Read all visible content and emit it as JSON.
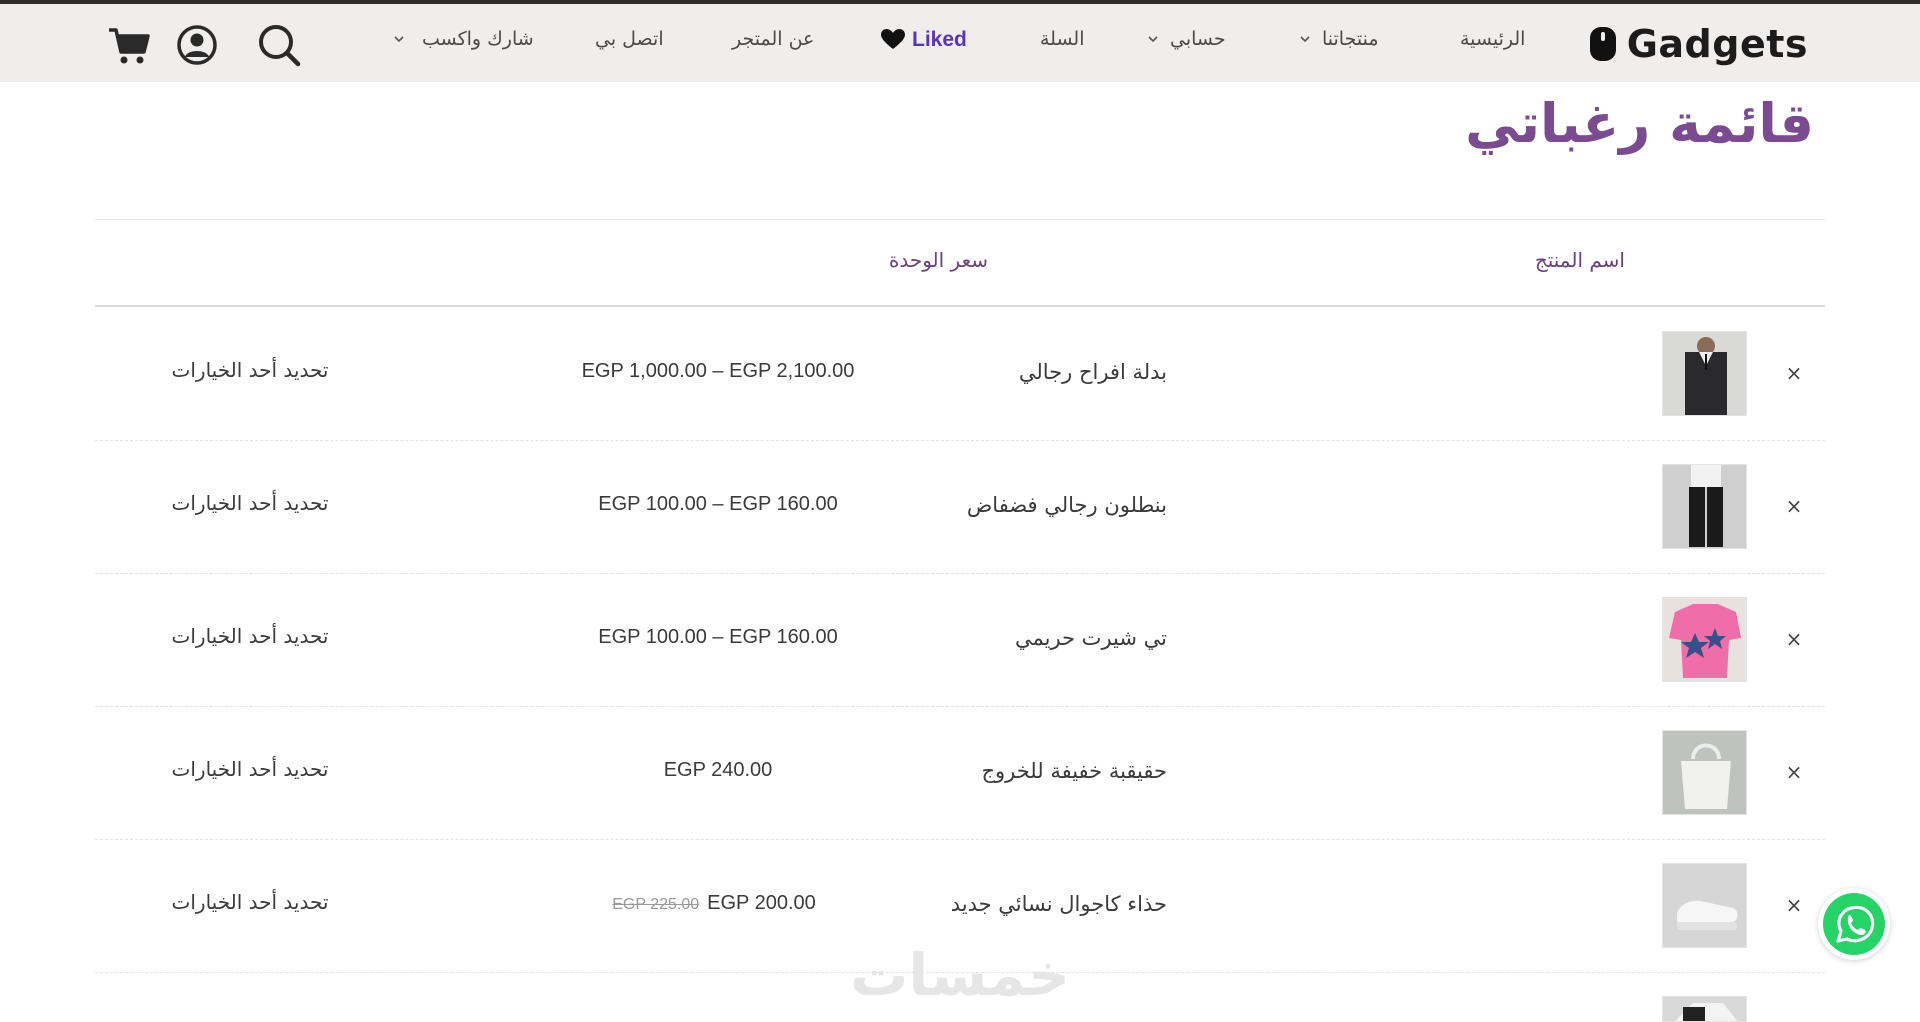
{
  "header": {
    "logo_text": "Gadgets",
    "nav": {
      "home": "الرئيسية",
      "products": "منتجاتنا",
      "account": "حسابي",
      "cart": "السلة",
      "liked": "Liked",
      "about": "عن المتجر",
      "contact": "اتصل بي",
      "share_earn": "شارك واكسب"
    },
    "icons": [
      "search-icon",
      "user-icon",
      "cart-icon",
      "heart-icon",
      "mouse-icon",
      "chevron-down-icon"
    ]
  },
  "page": {
    "title": "قائمة رغباتي"
  },
  "table": {
    "headers": {
      "product_name": "اسم المنتج",
      "unit_price": "سعر الوحدة"
    },
    "rows": [
      {
        "remove": "×",
        "name": "بدلة افراح رجالي",
        "price": "EGP 1,000.00 – EGP 2,100.00",
        "old_price": "",
        "action": "تحديد أحد الخيارات"
      },
      {
        "remove": "×",
        "name": "بنطلون رجالي فضفاض",
        "price": "EGP 100.00 – EGP 160.00",
        "old_price": "",
        "action": "تحديد أحد الخيارات"
      },
      {
        "remove": "×",
        "name": "تي شيرت حريمي",
        "price": "EGP 100.00 – EGP 160.00",
        "old_price": "",
        "action": "تحديد أحد الخيارات"
      },
      {
        "remove": "×",
        "name": "حقيقبة خفيفة للخروج",
        "price": "EGP 240.00",
        "old_price": "",
        "action": "تحديد أحد الخيارات"
      },
      {
        "remove": "×",
        "name": "حذاء كاجوال نسائي جديد",
        "price": "EGP 200.00",
        "old_price": "EGP 225.00",
        "action": "تحديد أحد الخيارات"
      }
    ]
  },
  "watermark": "خمسات",
  "colors": {
    "header_bg": "#efeeed",
    "title": "#7a4b91",
    "liked": "#5a35b8",
    "whatsapp": "#25d366"
  }
}
